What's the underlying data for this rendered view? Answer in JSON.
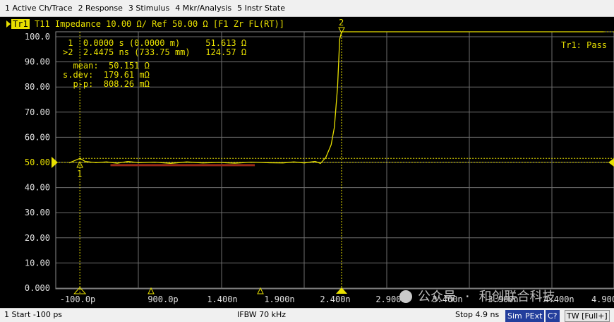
{
  "menu": [
    {
      "label": "1 Active Ch/Trace"
    },
    {
      "label": "2 Response"
    },
    {
      "label": "3 Stimulus"
    },
    {
      "label": "4 Mkr/Analysis"
    },
    {
      "label": "5 Instr State"
    }
  ],
  "trace": {
    "tag": "Tr1",
    "header": "T11 Impedance 10.00 Ω/ Ref 50.00 Ω [F1 Zr FL(RT)]",
    "limit_status": "Tr1: Pass",
    "ref_value_label": "50.00"
  },
  "markers": {
    "rows": [
      {
        "line": " 1  0.0000 s (0.0000 m)     51.613 Ω"
      },
      {
        "line": ">2  2.4475 ns (733.75 mm)   124.57 Ω"
      }
    ],
    "stats": [
      {
        "line": "  mean:  50.151 Ω"
      },
      {
        "line": "s.dev:  179.61 mΩ"
      },
      {
        "line": "  p-p:  808.26 mΩ"
      }
    ],
    "labels": [
      "1",
      "2"
    ]
  },
  "status": {
    "start": "1  Start -100 ps",
    "ifbw": "IFBW 70 kHz",
    "stop": "Stop 4.9 ns",
    "buttons": [
      "Sim",
      "PExt",
      "C?",
      "TW [Full+]"
    ]
  },
  "watermark": "公众号 · 和创联合科技",
  "colors": {
    "trace": "#e8e000",
    "grid": "#808080",
    "text": "#e8e000",
    "background": "#000000",
    "limit": "#9a2a18"
  },
  "chart_data": {
    "type": "line",
    "y_ticks": [
      "100.0",
      "90.00",
      "80.00",
      "70.00",
      "60.00",
      "50.00",
      "40.00",
      "30.00",
      "20.00",
      "10.00",
      "0.000"
    ],
    "x_ticks": [
      "-100.0p",
      "900.0p",
      "1.400n",
      "1.900n",
      "2.400n",
      "2.900n",
      "3.400n",
      "3.900n",
      "4.400n",
      "4.900"
    ],
    "xlim": [
      -0.1,
      4.9
    ],
    "ylim": [
      0,
      100
    ],
    "x_unit": "ns",
    "y_unit": "Ω",
    "series": [
      {
        "values": [
          [
            -0.1,
            49.8
          ],
          [
            0.0,
            51.6
          ],
          [
            0.05,
            50.4
          ],
          [
            0.15,
            49.9
          ],
          [
            0.25,
            50.2
          ],
          [
            0.35,
            49.7
          ],
          [
            0.45,
            50.4
          ],
          [
            0.55,
            49.9
          ],
          [
            0.7,
            50.1
          ],
          [
            0.85,
            49.6
          ],
          [
            1.0,
            50.2
          ],
          [
            1.15,
            49.8
          ],
          [
            1.3,
            50.0
          ],
          [
            1.45,
            49.7
          ],
          [
            1.6,
            50.1
          ],
          [
            1.75,
            49.9
          ],
          [
            1.9,
            49.8
          ],
          [
            2.0,
            50.2
          ],
          [
            2.1,
            49.8
          ],
          [
            2.2,
            50.4
          ],
          [
            2.25,
            49.6
          ],
          [
            2.3,
            52.0
          ],
          [
            2.35,
            57.0
          ],
          [
            2.38,
            64.0
          ],
          [
            2.41,
            80.0
          ],
          [
            2.43,
            99.0
          ],
          [
            2.4475,
            124.57
          ],
          [
            2.6,
            140.0
          ],
          [
            4.9,
            140.0
          ]
        ]
      }
    ],
    "limit_line": {
      "x": [
        0.55,
        1.9
      ],
      "y": 49.2
    },
    "marker_x": [
      0.0,
      2.4475
    ],
    "marker_y": [
      51.613,
      124.57
    ]
  }
}
